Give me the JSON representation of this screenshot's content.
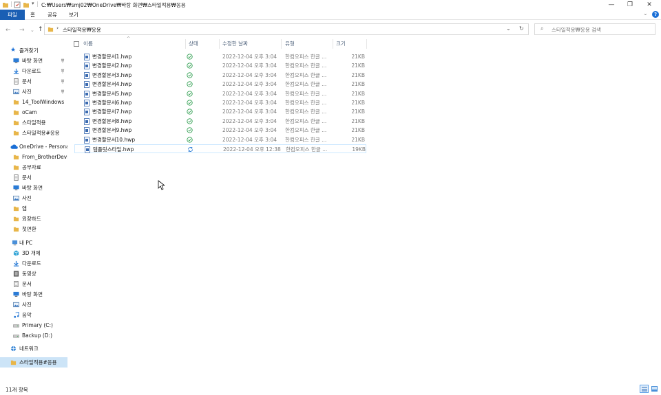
{
  "window": {
    "title": "C:₩Users₩smj02₩OneDrive₩바탕 화면₩스타일적용₩응용",
    "minimize": "—",
    "maximize": "❐",
    "close": "✕"
  },
  "ribbon": {
    "tabs": [
      {
        "label": "파일",
        "active": true
      },
      {
        "label": "홈",
        "active": false
      },
      {
        "label": "공유",
        "active": false
      },
      {
        "label": "보기",
        "active": false
      }
    ],
    "help": "?"
  },
  "address": {
    "path": [
      "스타일적용",
      "응용"
    ],
    "display": "스타일적용₩응용"
  },
  "search": {
    "placeholder": "스타일적용₩응용 검색"
  },
  "sidebar": {
    "quick_access": "즐겨찾기",
    "quick_items": [
      {
        "label": "바탕 화면",
        "icon": "desktop-icon",
        "pinned": true
      },
      {
        "label": "다운로드",
        "icon": "download-icon",
        "pinned": true
      },
      {
        "label": "문서",
        "icon": "document-icon",
        "pinned": true
      },
      {
        "label": "사진",
        "icon": "picture-icon",
        "pinned": true
      },
      {
        "label": "14_ToolWindows",
        "icon": "folder-icon",
        "pinned": false
      },
      {
        "label": "oCam",
        "icon": "folder-icon",
        "pinned": false
      },
      {
        "label": "스타일적용",
        "icon": "folder-icon",
        "pinned": false
      },
      {
        "label": "스타일적용#응용",
        "icon": "folder-icon",
        "pinned": false
      }
    ],
    "onedrive": "OneDrive - Personal",
    "onedrive_items": [
      {
        "label": "From_BrotherDevice",
        "icon": "folder-icon"
      },
      {
        "label": "공부자료",
        "icon": "folder-icon"
      },
      {
        "label": "문서",
        "icon": "document-icon"
      },
      {
        "label": "바탕 화면",
        "icon": "desktop-icon"
      },
      {
        "label": "사진",
        "icon": "picture-icon"
      },
      {
        "label": "앱",
        "icon": "folder-icon"
      },
      {
        "label": "외장하드",
        "icon": "folder-icon"
      },
      {
        "label": "첫면환",
        "icon": "folder-icon"
      }
    ],
    "this_pc": "내 PC",
    "pc_items": [
      {
        "label": "3D 개체",
        "icon": "3d-objects-icon"
      },
      {
        "label": "다운로드",
        "icon": "download-icon"
      },
      {
        "label": "동영상",
        "icon": "video-icon"
      },
      {
        "label": "문서",
        "icon": "document-icon"
      },
      {
        "label": "바탕 화면",
        "icon": "desktop-icon"
      },
      {
        "label": "사진",
        "icon": "picture-icon"
      },
      {
        "label": "음악",
        "icon": "music-icon"
      },
      {
        "label": "Primary (C:)",
        "icon": "drive-icon"
      },
      {
        "label": "Backup (D:)",
        "icon": "drive-icon"
      }
    ],
    "network": "네트워크",
    "selected": "스타일적용#응용"
  },
  "columns": {
    "name": "이름",
    "status": "상태",
    "modified": "수정한 날짜",
    "type": "유형",
    "size": "크기"
  },
  "files": [
    {
      "name": "변경할문서1.hwp",
      "status": "synced",
      "modified": "2022-12-04 오후 3:04",
      "type": "한컴오피스 한글 ...",
      "size": "21KB"
    },
    {
      "name": "변경할문서2.hwp",
      "status": "synced",
      "modified": "2022-12-04 오후 3:04",
      "type": "한컴오피스 한글 ...",
      "size": "21KB"
    },
    {
      "name": "변경할문서3.hwp",
      "status": "synced",
      "modified": "2022-12-04 오후 3:04",
      "type": "한컴오피스 한글 ...",
      "size": "21KB"
    },
    {
      "name": "변경할문서4.hwp",
      "status": "synced",
      "modified": "2022-12-04 오후 3:04",
      "type": "한컴오피스 한글 ...",
      "size": "21KB"
    },
    {
      "name": "변경할문서5.hwp",
      "status": "synced",
      "modified": "2022-12-04 오후 3:04",
      "type": "한컴오피스 한글 ...",
      "size": "21KB"
    },
    {
      "name": "변경할문서6.hwp",
      "status": "synced",
      "modified": "2022-12-04 오후 3:04",
      "type": "한컴오피스 한글 ...",
      "size": "21KB"
    },
    {
      "name": "변경할문서7.hwp",
      "status": "synced",
      "modified": "2022-12-04 오후 3:04",
      "type": "한컴오피스 한글 ...",
      "size": "21KB"
    },
    {
      "name": "변경할문서8.hwp",
      "status": "synced",
      "modified": "2022-12-04 오후 3:04",
      "type": "한컴오피스 한글 ...",
      "size": "21KB"
    },
    {
      "name": "변경할문서9.hwp",
      "status": "synced",
      "modified": "2022-12-04 오후 3:04",
      "type": "한컴오피스 한글 ...",
      "size": "21KB"
    },
    {
      "name": "변경할문서10.hwp",
      "status": "synced",
      "modified": "2022-12-04 오후 3:04",
      "type": "한컴오피스 한글 ...",
      "size": "21KB"
    },
    {
      "name": "템플릿스타일.hwp",
      "status": "syncing",
      "modified": "2022-12-04 오후 12:38",
      "type": "한컴오피스 한글 ...",
      "size": "19KB"
    }
  ],
  "status_bar": {
    "count": "11개 항목"
  },
  "colors": {
    "accent": "#1a5fb4",
    "selection": "#cce4f7",
    "sync_ok": "#2e9e4f",
    "sync_pending": "#2a7bd6",
    "folder": "#e8b64a"
  }
}
